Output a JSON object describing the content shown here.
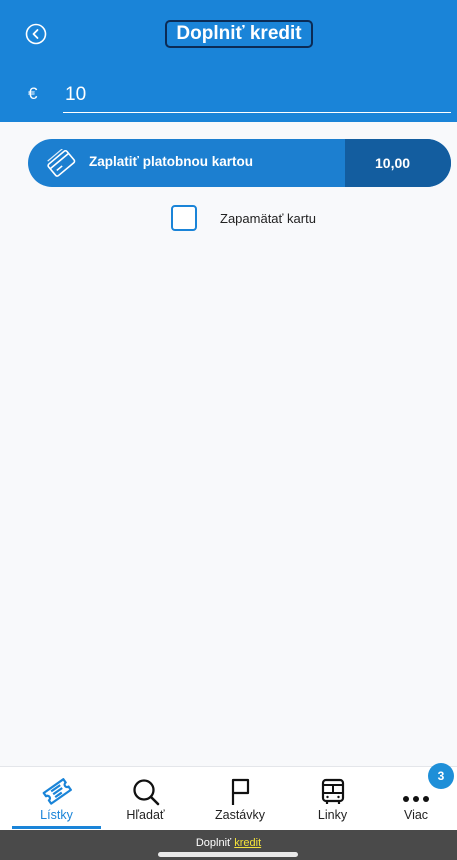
{
  "header": {
    "title": "Doplniť kredit",
    "back_icon": "back-circle-icon"
  },
  "amount": {
    "currency": "€",
    "value": "10"
  },
  "payment": {
    "label": "Zaplatiť platobnou kartou",
    "amount": "10,00",
    "icon": "credit-card-icon"
  },
  "remember_card": {
    "label": "Zapamätať kartu",
    "checked": false
  },
  "tabs": [
    {
      "label": "Lístky",
      "icon": "ticket-icon",
      "active": true
    },
    {
      "label": "Hľadať",
      "icon": "search-icon",
      "active": false
    },
    {
      "label": "Zastávky",
      "icon": "flag-icon",
      "active": false
    },
    {
      "label": "Linky",
      "icon": "bus-icon",
      "active": false
    },
    {
      "label": "Viac",
      "icon": "more-icon",
      "active": false
    }
  ],
  "more_badge": "3",
  "bottom_bar": {
    "prefix": "Doplniť",
    "link": "kredit"
  },
  "colors": {
    "primary": "#1a84d8",
    "pay_amount_bg": "#135d9f",
    "link_yellow": "#f5e33a"
  }
}
